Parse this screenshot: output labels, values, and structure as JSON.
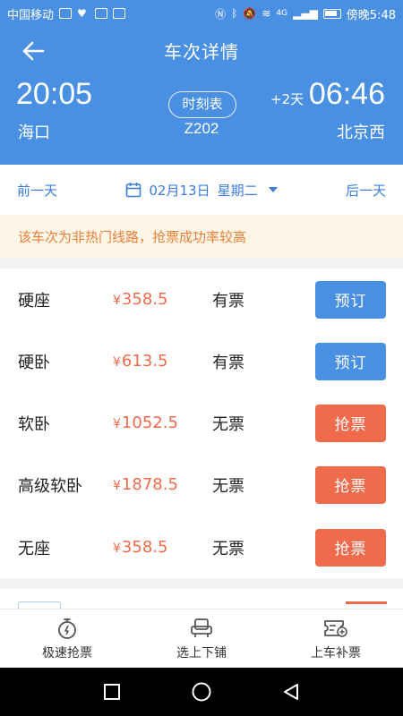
{
  "status_bar": {
    "carrier": "中国移动",
    "time": "傍晚5:48",
    "network": "4G"
  },
  "header": {
    "title": "车次详情",
    "departure": {
      "time": "20:05",
      "station": "海口"
    },
    "arrival": {
      "day_offset": "+2天",
      "time": "06:46",
      "station": "北京西"
    },
    "schedule_label": "时刻表",
    "train_number": "Z202"
  },
  "date_bar": {
    "prev_label": "前一天",
    "date": "02月13日",
    "weekday": "星期二",
    "next_label": "后一天"
  },
  "notice": "该车次为非热门线路，抢票成功率较高",
  "seats": [
    {
      "name": "硬座",
      "currency": "¥",
      "price": "358.5",
      "availability": "有票",
      "action": "预订"
    },
    {
      "name": "硬卧",
      "currency": "¥",
      "price": "613.5",
      "availability": "有票",
      "action": "预订"
    },
    {
      "name": "软卧",
      "currency": "¥",
      "price": "1052.5",
      "availability": "无票",
      "action": "抢票"
    },
    {
      "name": "高级软卧",
      "currency": "¥",
      "price": "1878.5",
      "availability": "无票",
      "action": "抢票"
    },
    {
      "name": "无座",
      "currency": "¥",
      "price": "358.5",
      "availability": "无票",
      "action": "抢票"
    }
  ],
  "bottom_nav": [
    {
      "label": "极速抢票",
      "icon": "stopwatch-icon"
    },
    {
      "label": "选上下铺",
      "icon": "seat-icon"
    },
    {
      "label": "上车补票",
      "icon": "ticket-add-icon"
    }
  ],
  "colors": {
    "primary": "#4a90e2",
    "accent": "#f06a4c",
    "notice_bg": "#fdf6e6",
    "notice_text": "#e8803a"
  }
}
